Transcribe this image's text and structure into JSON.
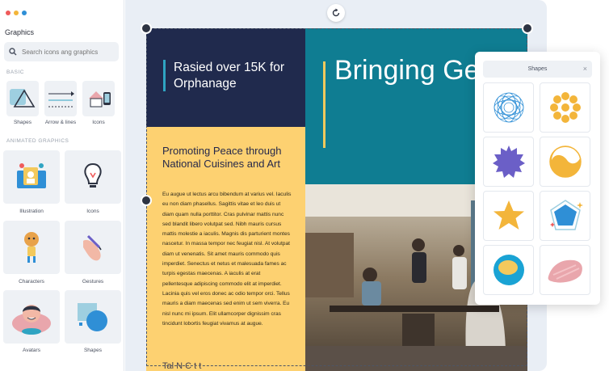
{
  "sidebar": {
    "title": "Graphics",
    "search_placeholder": "Search icons ang graphics",
    "basic_label": "BASIC",
    "basic_items": [
      {
        "label": "Shapes",
        "icon": "shapes-icon"
      },
      {
        "label": "Arrow & lines",
        "icon": "arrow-lines-icon"
      },
      {
        "label": "Icons",
        "icon": "icons-icon"
      }
    ],
    "animated_label": "ANIMATED GRAPHICS",
    "animated_items": [
      {
        "label": "Illustration",
        "icon": "illustration-icon"
      },
      {
        "label": "Icons",
        "icon": "lightbulb-icon"
      },
      {
        "label": "Characters",
        "icon": "character-icon"
      },
      {
        "label": "Gestures",
        "icon": "hand-pen-icon"
      },
      {
        "label": "Avatars",
        "icon": "avatar-icon"
      },
      {
        "label": "Shapes",
        "icon": "shape-collage-icon"
      }
    ]
  },
  "design": {
    "navy_text": "Rasied over 15K for Orphanage",
    "title": "Bringing Generations Together",
    "subheading": "Promoting Peace through National Cuisines and Art",
    "body": "Eu augue ut lectus arcu bibendum at varius vel. Iaculis eu non diam phasellus. Sagittis vitae et leo duis ut diam quam nulla porttitor. Cras pulvinar mattis nunc sed blandit libero volutpat sed. Nibh mauris cursus mattis molestie a iaculis. Magnis dis parturient montes nascetur. In massa tempor nec feugiat nisl. At volutpat diam ut venenatis. Sit amet mauris commodo quis imperdiet. Senectus et netus et malesuada fames ac turpis egestas maecenas. A iaculis at erat pellentesque adipiscing commodo elit at imperdiet. Lacinia quis vel eros donec ac odio tempor orci. Tellus mauris a diam maecenas sed enim ut sem viverra. Eu nisl nunc mi ipsum. Elit ullamcorper dignissim cras tincidunt lobortis feugiat vivamus at augue.",
    "footer_partial": "Tal    N    C         t  t"
  },
  "shapes_panel": {
    "title": "Shapes",
    "close_glyph": "×",
    "items": [
      "spiral-circle-icon",
      "flower-dots-icon",
      "gear-burst-icon",
      "yin-yang-icon",
      "star-icon",
      "gem-sparkle-icon",
      "ring-blob-icon",
      "brush-stroke-icon"
    ]
  },
  "colors": {
    "navy": "#202a4d",
    "teal": "#0f7d92",
    "yellow": "#fdd171",
    "accent_blue": "#2fa4c2",
    "shape_blue": "#2f8fd6",
    "shape_orange": "#f3b53a",
    "shape_purple": "#6b5fc7",
    "shape_pink": "#e9a6ac"
  }
}
